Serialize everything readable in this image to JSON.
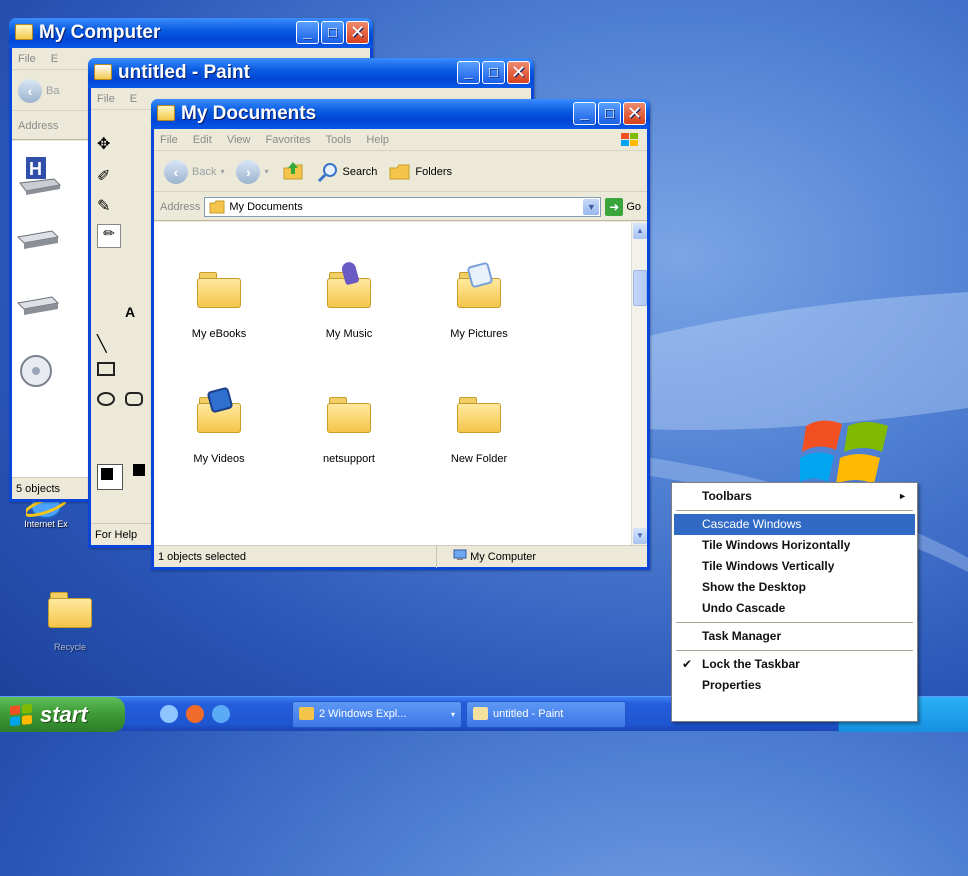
{
  "colors": {
    "titlebar": "#0a5ce0",
    "selection": "#316ac5",
    "start": "#3c9a34",
    "taskbar": "#245edc"
  },
  "desktop": {
    "icons": [
      {
        "label": "Internet Ex",
        "icon": "internet-explorer-icon"
      },
      {
        "label": "Recycle",
        "icon": "folder-icon"
      }
    ]
  },
  "my_computer": {
    "title": "My Computer",
    "menu": [
      "File",
      "E"
    ],
    "back_label": "Ba",
    "address_label": "Address",
    "status": "5 objects"
  },
  "paint": {
    "title": "untitled - Paint",
    "menu": [
      "File",
      "E"
    ],
    "status": "For Help"
  },
  "my_documents": {
    "title": "My Documents",
    "menu": [
      "File",
      "Edit",
      "View",
      "Favorites",
      "Tools",
      "Help"
    ],
    "toolbar": {
      "back": "Back",
      "search": "Search",
      "folders": "Folders"
    },
    "address_label": "Address",
    "address_value": "My Documents",
    "go_label": "Go",
    "items": [
      {
        "label": "My eBooks",
        "icon": "folder-icon"
      },
      {
        "label": "My Music",
        "icon": "music-folder-icon"
      },
      {
        "label": "My Pictures",
        "icon": "pictures-folder-icon"
      },
      {
        "label": "My Videos",
        "icon": "videos-folder-icon"
      },
      {
        "label": "netsupport",
        "icon": "folder-icon"
      },
      {
        "label": "New Folder",
        "icon": "folder-icon"
      }
    ],
    "status_left": "1 objects selected",
    "status_right": "My Computer"
  },
  "context_menu": {
    "items": [
      {
        "label": "Toolbars",
        "submenu": true
      },
      {
        "label": "Cascade Windows",
        "selected": true
      },
      {
        "label": "Tile Windows Horizontally"
      },
      {
        "label": "Tile Windows Vertically"
      },
      {
        "label": "Show the Desktop"
      },
      {
        "label": "Undo Cascade"
      },
      {
        "label": "Task Manager"
      },
      {
        "label": "Lock the Taskbar",
        "checked": true
      },
      {
        "label": "Properties"
      }
    ]
  },
  "taskbar": {
    "start_label": "start",
    "buttons": [
      {
        "label": "2 Windows Expl..."
      },
      {
        "label": "untitled - Paint"
      }
    ]
  }
}
